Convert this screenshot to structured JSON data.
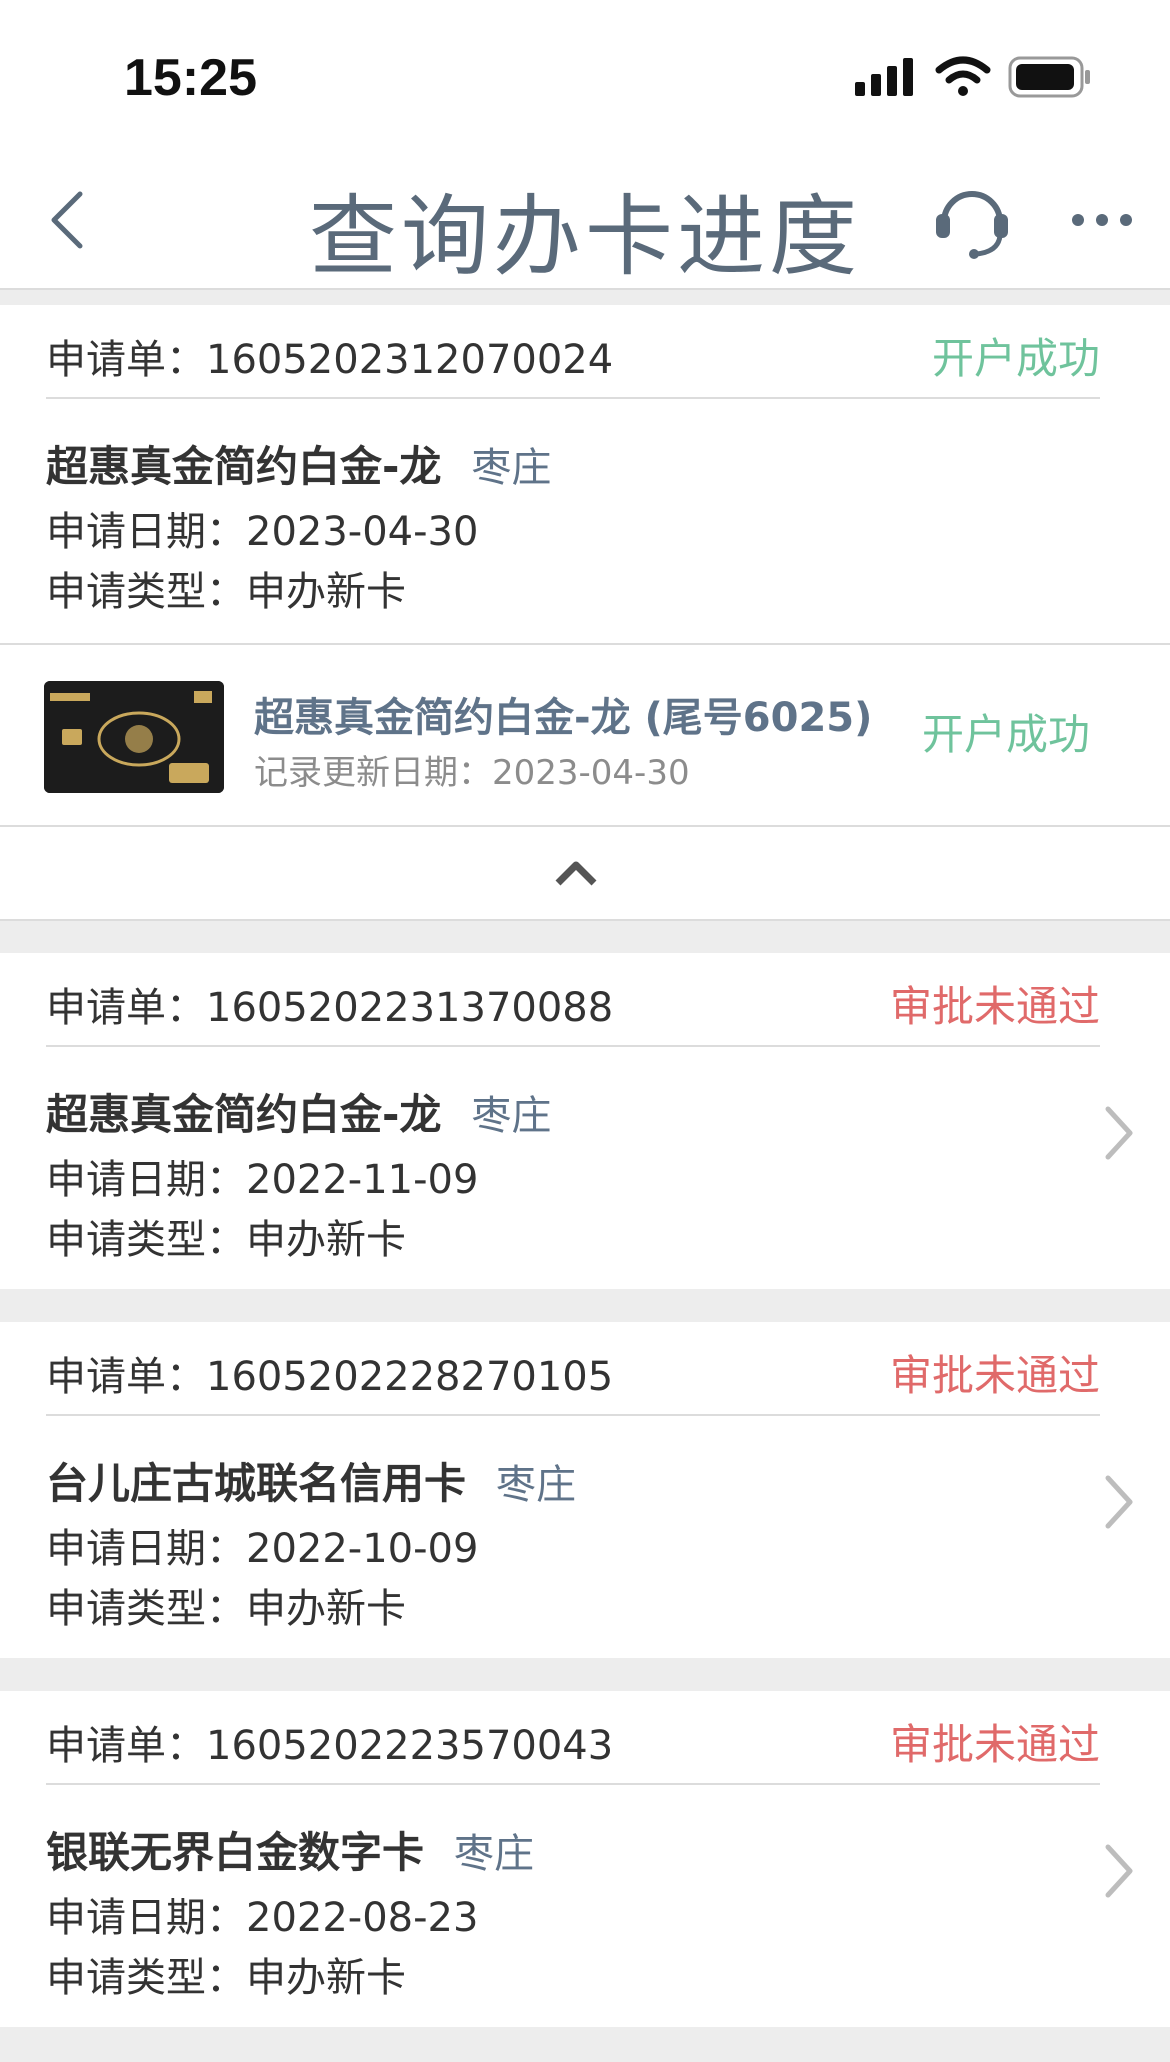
{
  "status_bar": {
    "time": "15:25"
  },
  "nav": {
    "title": "查询办卡进度"
  },
  "colors": {
    "success": "#6fc39c",
    "fail": "#e06a6a",
    "accent": "#5f7389"
  },
  "applications": [
    {
      "order_label": "申请单：1605202312070024",
      "status": "开户成功",
      "status_type": "success",
      "card_name": "超惠真金简约白金-龙",
      "city": "枣庄",
      "apply_date": "申请日期：2023-04-30",
      "apply_type": "申请类型：申办新卡",
      "expanded": true,
      "issued_card": {
        "name": "超惠真金简约白金-龙 (尾号6025)",
        "update_date": "记录更新日期：2023-04-30",
        "status": "开户成功"
      }
    },
    {
      "order_label": "申请单：1605202231370088",
      "status": "审批未通过",
      "status_type": "fail",
      "card_name": "超惠真金简约白金-龙",
      "city": "枣庄",
      "apply_date": "申请日期：2022-11-09",
      "apply_type": "申请类型：申办新卡"
    },
    {
      "order_label": "申请单：1605202228270105",
      "status": "审批未通过",
      "status_type": "fail",
      "card_name": "台儿庄古城联名信用卡",
      "city": "枣庄",
      "apply_date": "申请日期：2022-10-09",
      "apply_type": "申请类型：申办新卡"
    },
    {
      "order_label": "申请单：1605202223570043",
      "status": "审批未通过",
      "status_type": "fail",
      "card_name": "银联无界白金数字卡",
      "city": "枣庄",
      "apply_date": "申请日期：2022-08-23",
      "apply_type": "申请类型：申办新卡"
    }
  ]
}
